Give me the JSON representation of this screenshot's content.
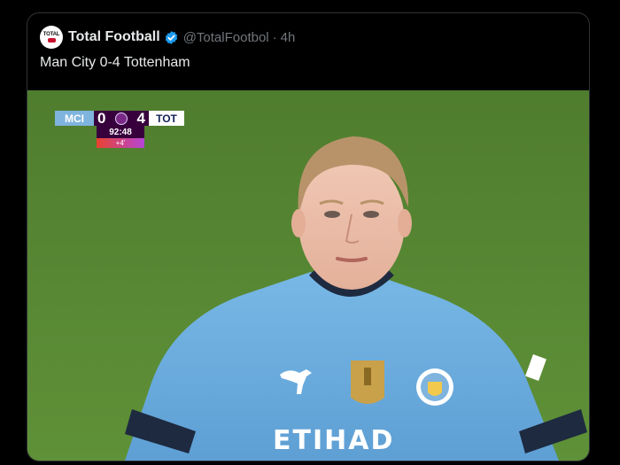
{
  "tweet": {
    "author_name": "Total Football",
    "handle": "@TotalFootbol",
    "separator": "·",
    "time": "4h",
    "text": "Man City 0-4 Tottenham",
    "avatar_text": "TOTAL",
    "verified": true
  },
  "scoreboard": {
    "home_team": "MCI",
    "home_score": "0",
    "away_score": "4",
    "away_team": "TOT",
    "clock": "92:48",
    "added_time": "+4'",
    "colors": {
      "home": "#7fb4de",
      "league": "#37003c",
      "away_bg": "#ffffff"
    }
  },
  "media": {
    "kit_sponsor": "ETIHAD",
    "icons": [
      "premier-league-lion-icon",
      "puma-logo-icon",
      "fifa-badge-icon",
      "man-city-crest-icon"
    ],
    "colors": {
      "pitch": "#5a8a35",
      "shirt": "#6aaee0"
    }
  },
  "colors": {
    "background": "#000000",
    "text_primary": "#e7e9ea",
    "text_secondary": "#71767b",
    "verified_blue": "#1d9bf0",
    "border": "#2f3336"
  }
}
